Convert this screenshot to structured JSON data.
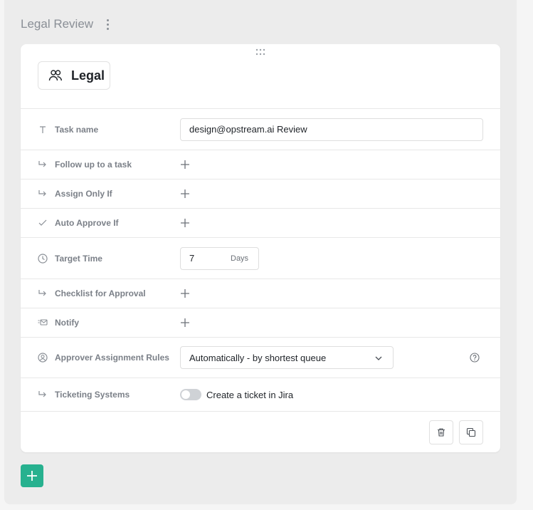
{
  "section": {
    "title": "Legal Review"
  },
  "card": {
    "chip_label": "Legal",
    "rows": {
      "task_name": {
        "label": "Task name",
        "value": "design@opstream.ai Review"
      },
      "follow_up": {
        "label": "Follow up to a task"
      },
      "assign_only_if": {
        "label": "Assign Only If"
      },
      "auto_approve_if": {
        "label": "Auto Approve If"
      },
      "target_time": {
        "label": "Target Time",
        "value": "7",
        "unit": "Days"
      },
      "checklist": {
        "label": "Checklist for Approval"
      },
      "notify": {
        "label": "Notify"
      },
      "approver_rules": {
        "label": "Approver Assignment Rules",
        "selected": "Automatically - by shortest queue"
      },
      "ticketing": {
        "label": "Ticketing Systems",
        "toggle_label": "Create a ticket in Jira",
        "toggle_on": false
      }
    }
  },
  "colors": {
    "accent": "#27b18f",
    "label": "#7b8088",
    "border": "#e8e8e8"
  }
}
